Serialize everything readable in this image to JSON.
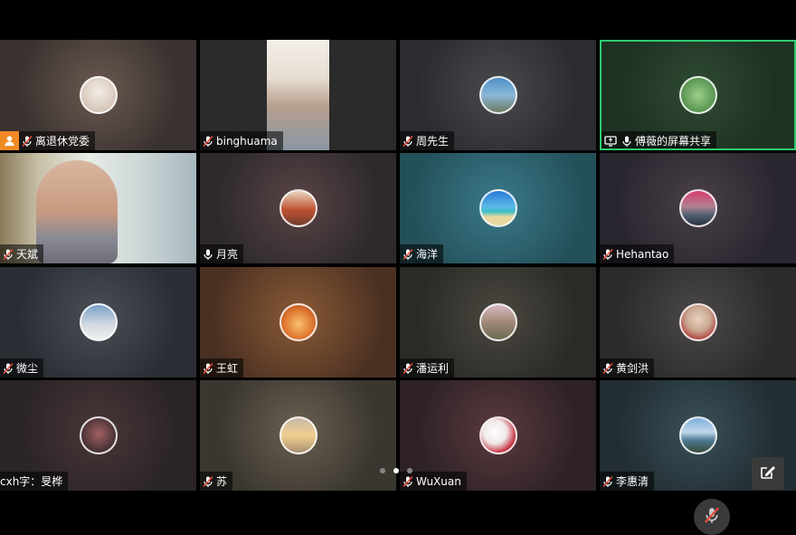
{
  "participants": [
    {
      "name": "离退休党委",
      "host": true
    },
    {
      "name": "binghuama"
    },
    {
      "name": "周先生"
    },
    {
      "name": "傅薇的屏幕共享",
      "sharing": true
    },
    {
      "name": "天斌"
    },
    {
      "name": "月亮"
    },
    {
      "name": "海洋"
    },
    {
      "name": "Hehantao"
    },
    {
      "name": "微尘"
    },
    {
      "name": "王虹"
    },
    {
      "name": "潘运利"
    },
    {
      "name": "黄剑洪"
    },
    {
      "name": "cxh字：旻桦"
    },
    {
      "name": "苏"
    },
    {
      "name": "WuXuan"
    },
    {
      "name": "李惠清"
    }
  ],
  "icons": {
    "muted_mic": "mic-muted-icon",
    "mic": "mic-icon",
    "host": "person-icon",
    "screen_share": "screen-share-icon",
    "annotate": "annotate-icon"
  },
  "pager": {
    "pages": 3,
    "current": 2
  },
  "colors": {
    "active_border": "#2ecc71",
    "host_badge": "#f08a24"
  }
}
